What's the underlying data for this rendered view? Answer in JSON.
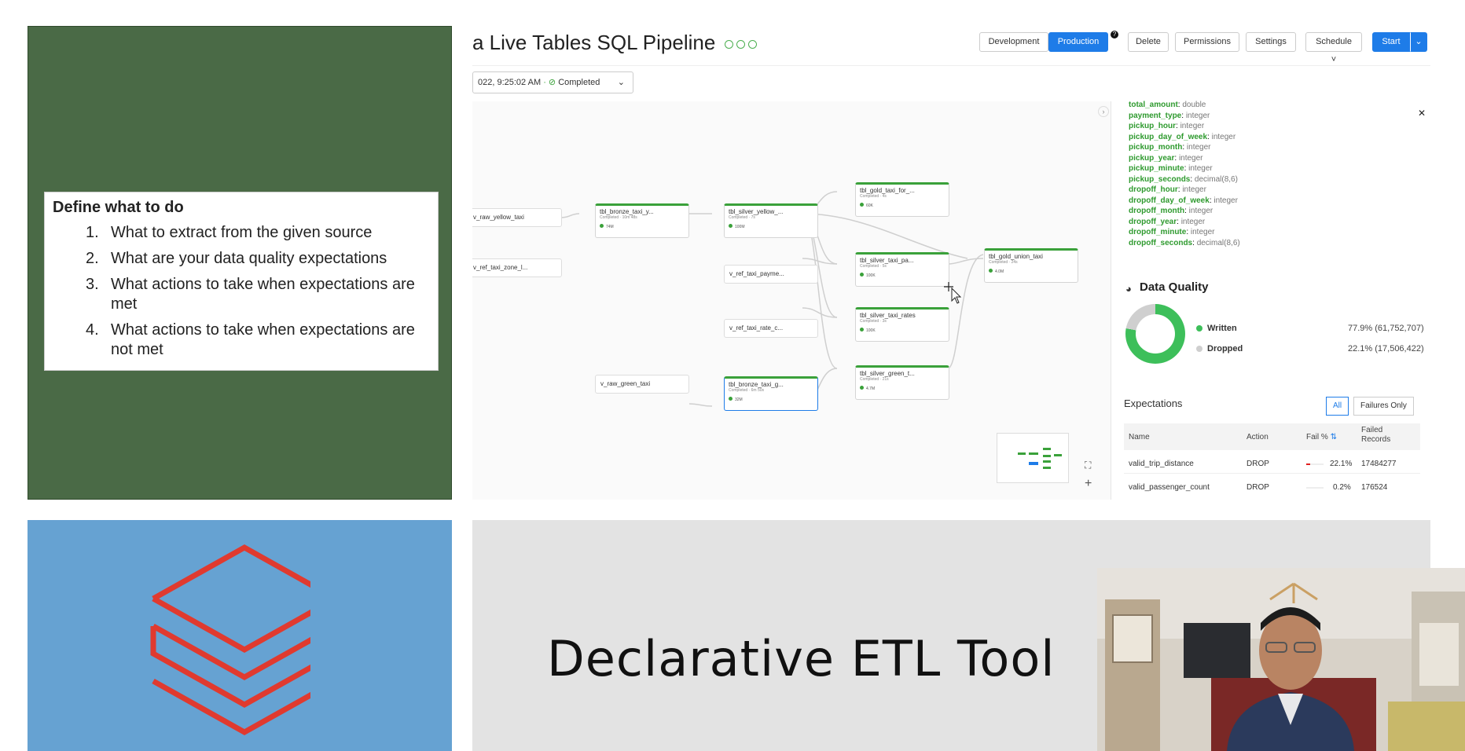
{
  "left_panel": {
    "title": "Define what to do",
    "items": [
      {
        "num": "1.",
        "text": "What to extract from the given source"
      },
      {
        "num": "2.",
        "text": "What are your data quality expectations"
      },
      {
        "num": "3.",
        "text": "What actions to take when expectations are met"
      },
      {
        "num": "4.",
        "text": "What actions to take when expectations are not met"
      }
    ]
  },
  "bottom": {
    "title": "Declarative ETL Tool"
  },
  "colors": {
    "green_panel": "#4a6a46",
    "blue_panel": "#66a2d2",
    "logo_red": "#e03a2f",
    "accent": "#1e7ce8",
    "success": "#3aa13a"
  },
  "pipeline": {
    "title": "a Live Tables SQL Pipeline",
    "toolbar": {
      "development": "Development",
      "production": "Production",
      "delete": "Delete",
      "permissions": "Permissions",
      "settings": "Settings",
      "schedule": "Schedule",
      "start": "Start"
    },
    "run": {
      "time": "022, 9:25:02 AM",
      "status": "Completed"
    },
    "views": {
      "raw_yellow": "v_raw_yellow_taxi",
      "ref_zone": "v_ref_taxi_zone_l...",
      "ref_payment": "v_ref_taxi_payme...",
      "ref_rate": "v_ref_taxi_rate_c...",
      "raw_green": "v_raw_green_taxi"
    },
    "tables": {
      "bronze_yellow": {
        "name": "tbl_bronze_taxi_y...",
        "sub": "Completed · 10m 48s",
        "meta": "74M"
      },
      "silver_yellow": {
        "name": "tbl_silver_yellow_...",
        "sub": "Completed · 7s",
        "meta": "100M"
      },
      "gold_taxi_for": {
        "name": "tbl_gold_taxi_for_...",
        "sub": "Completed · 4s",
        "meta": "60K"
      },
      "silver_taxi_pa": {
        "name": "tbl_silver_taxi_pa...",
        "sub": "Completed · 5s",
        "meta": "100K"
      },
      "silver_taxi_rates": {
        "name": "tbl_silver_taxi_rates",
        "sub": "Completed · 3s",
        "meta": "100K"
      },
      "bronze_green": {
        "name": "tbl_bronze_taxi_g...",
        "sub": "Completed · 6m 50s",
        "meta": "32M"
      },
      "silver_green": {
        "name": "tbl_silver_green_t...",
        "sub": "Completed · 21s",
        "meta": "4.7M"
      },
      "gold_union": {
        "name": "tbl_gold_union_taxi",
        "sub": "Completed · 24s",
        "meta": "4.0M"
      }
    },
    "schema": [
      {
        "k": "total_amount",
        "t": "double"
      },
      {
        "k": "payment_type",
        "t": "integer"
      },
      {
        "k": "pickup_hour",
        "t": "integer"
      },
      {
        "k": "pickup_day_of_week",
        "t": "integer"
      },
      {
        "k": "pickup_month",
        "t": "integer"
      },
      {
        "k": "pickup_year",
        "t": "integer"
      },
      {
        "k": "pickup_minute",
        "t": "integer"
      },
      {
        "k": "pickup_seconds",
        "t": "decimal(8,6)"
      },
      {
        "k": "dropoff_hour",
        "t": "integer"
      },
      {
        "k": "dropoff_day_of_week",
        "t": "integer"
      },
      {
        "k": "dropoff_month",
        "t": "integer"
      },
      {
        "k": "dropoff_year",
        "t": "integer"
      },
      {
        "k": "dropoff_minute",
        "t": "integer"
      },
      {
        "k": "dropoff_seconds",
        "t": "decimal(8,6)"
      }
    ],
    "data_quality": {
      "title": "Data Quality",
      "written_label": "Written",
      "written_value": "77.9% (61,752,707)",
      "dropped_label": "Dropped",
      "dropped_value": "22.1% (17,506,422)",
      "written_fraction": 0.779
    },
    "expectations": {
      "title": "Expectations",
      "tab_all": "All",
      "tab_failures": "Failures Only",
      "headers": {
        "name": "Name",
        "action": "Action",
        "fail": "Fail %",
        "failed": "Failed Records"
      },
      "rows": [
        {
          "name": "valid_trip_distance",
          "action": "DROP",
          "fail": "22.1%",
          "failed": "17484277"
        },
        {
          "name": "valid_passenger_count",
          "action": "DROP",
          "fail": "0.2%",
          "failed": "176524"
        }
      ]
    }
  }
}
